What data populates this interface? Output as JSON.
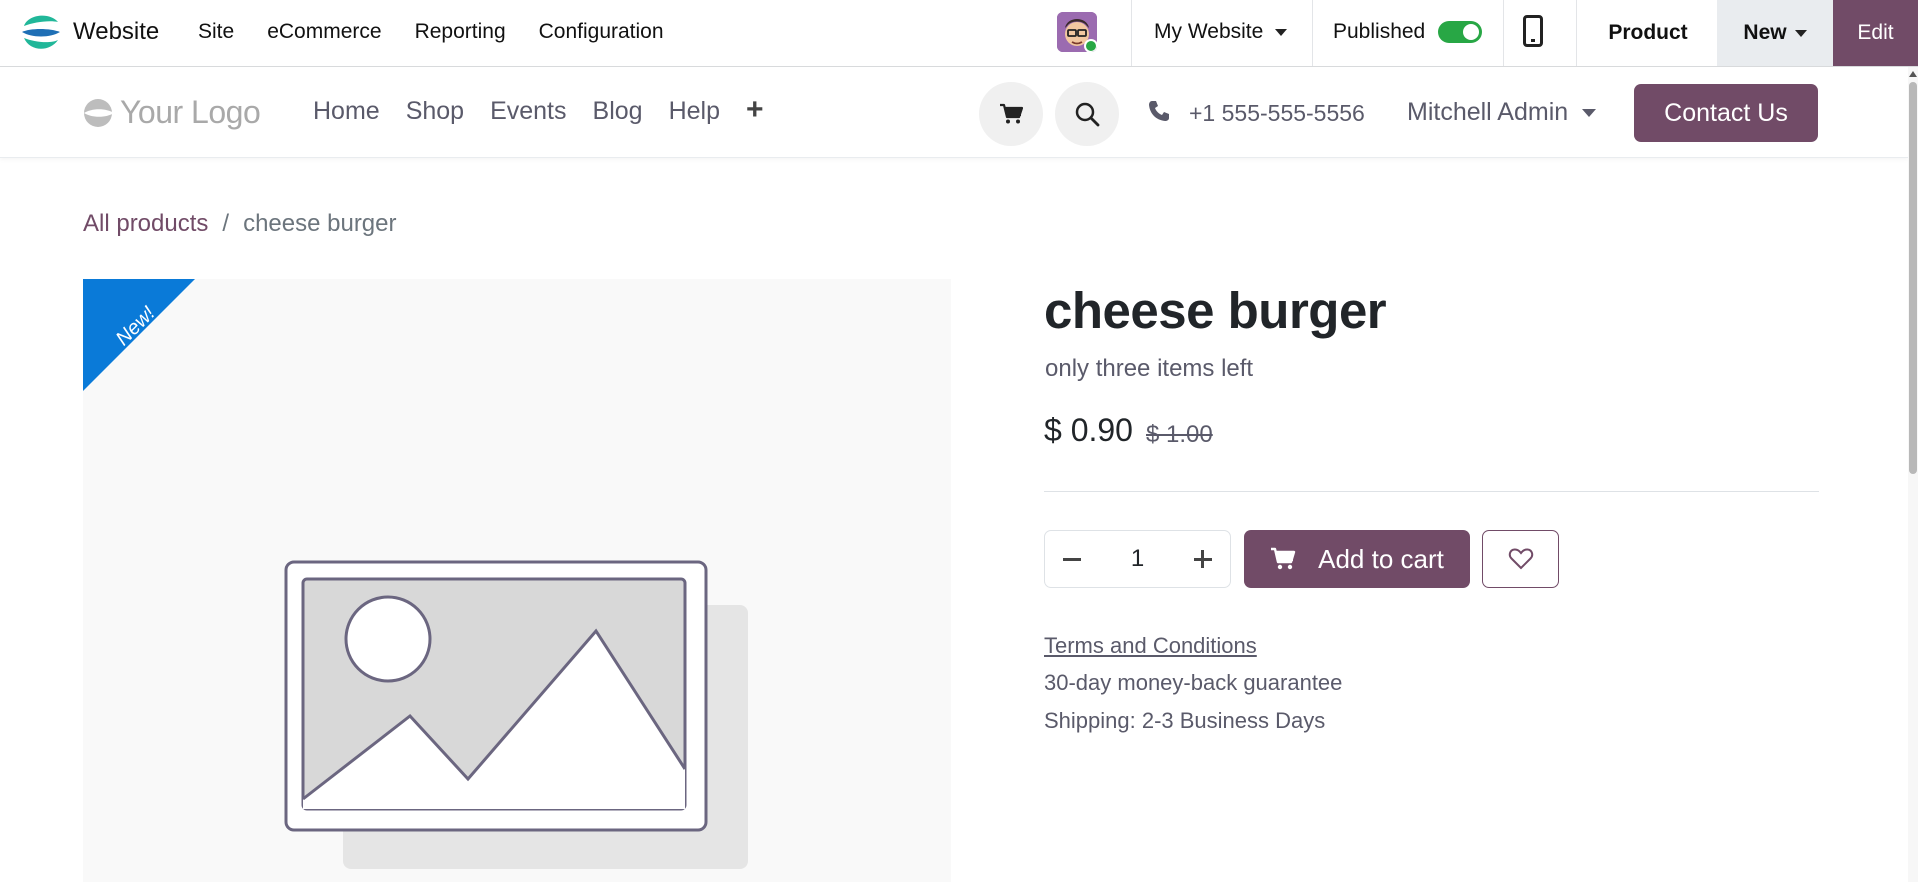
{
  "topbar": {
    "app_name": "Website",
    "menu": [
      "Site",
      "eCommerce",
      "Reporting",
      "Configuration"
    ],
    "website_selector": "My Website",
    "published_label": "Published",
    "published": true,
    "product_label": "Product",
    "new_label": "New",
    "edit_label": "Edit"
  },
  "header": {
    "logo_text": "Your Logo",
    "nav": [
      "Home",
      "Shop",
      "Events",
      "Blog",
      "Help"
    ],
    "phone": "+1 555-555-5556",
    "user": "Mitchell Admin",
    "contact_label": "Contact Us"
  },
  "breadcrumb": {
    "parent": "All products",
    "separator": "/",
    "current": "cheese burger"
  },
  "product": {
    "ribbon": "New!",
    "name": "cheese burger",
    "description": "only three items left",
    "price": "$ 0.90",
    "old_price": "$ 1.00",
    "quantity": "1",
    "add_to_cart_label": "Add to cart",
    "terms_label": "Terms and Conditions",
    "guarantee": "30-day money-back guarantee",
    "shipping": "Shipping: 2-3 Business Days"
  },
  "colors": {
    "brand": "#714b67",
    "ribbon": "#0a7ad8",
    "toggle_on": "#28a745"
  }
}
